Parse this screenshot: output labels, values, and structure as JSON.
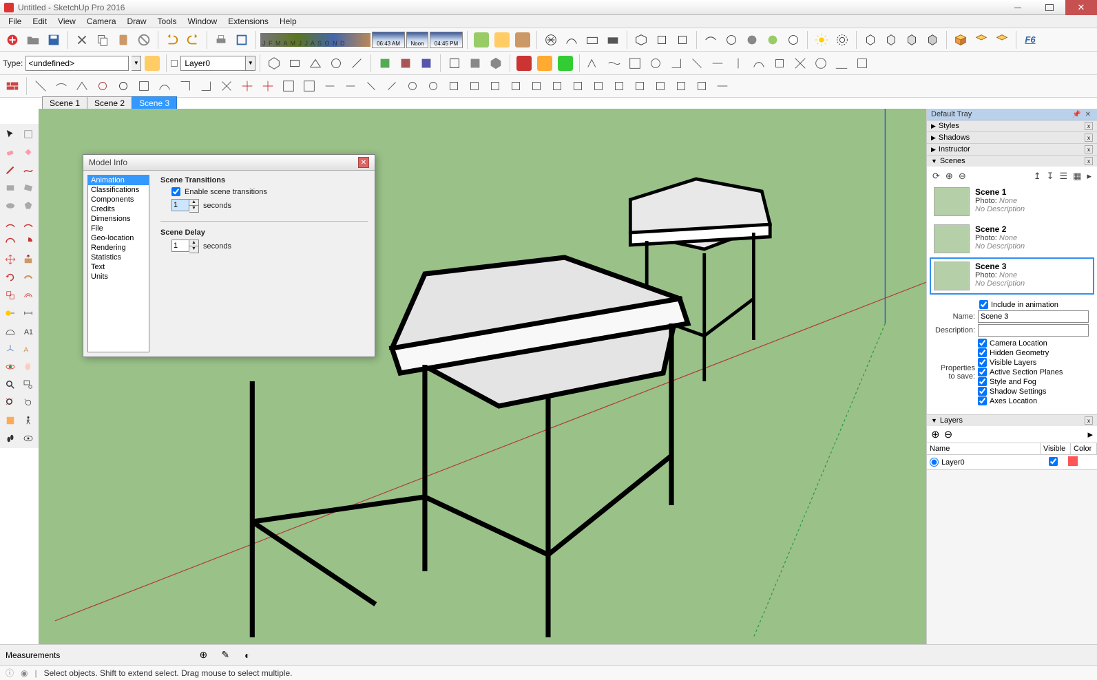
{
  "titlebar": {
    "title": "Untitled - SketchUp Pro 2016"
  },
  "menu": [
    "File",
    "Edit",
    "View",
    "Camera",
    "Draw",
    "Tools",
    "Window",
    "Extensions",
    "Help"
  ],
  "type_label": "Type:",
  "type_value": "<undefined>",
  "layer_dropdown": "Layer0",
  "month_letters": "J F M A M J J A S O N D",
  "time_boxes": {
    "am": "06:43 AM",
    "noon": "Noon",
    "pm": "04:45 PM"
  },
  "scene_tabs": [
    {
      "label": "Scene 1",
      "active": false
    },
    {
      "label": "Scene 2",
      "active": false
    },
    {
      "label": "Scene 3",
      "active": true
    }
  ],
  "tray": {
    "title": "Default Tray",
    "sections": {
      "styles": "Styles",
      "shadows": "Shadows",
      "instructor": "Instructor",
      "scenes": "Scenes",
      "layers": "Layers"
    }
  },
  "scenes_list": [
    {
      "name": "Scene 1",
      "photo_label": "Photo:",
      "photo_value": "None",
      "desc": "No Description",
      "selected": false
    },
    {
      "name": "Scene 2",
      "photo_label": "Photo:",
      "photo_value": "None",
      "desc": "No Description",
      "selected": false
    },
    {
      "name": "Scene 3",
      "photo_label": "Photo:",
      "photo_value": "None",
      "desc": "No Description",
      "selected": true
    }
  ],
  "scene_props": {
    "include_label": "Include in animation",
    "name_label": "Name:",
    "name_value": "Scene 3",
    "desc_label": "Description:",
    "desc_value": "",
    "props_label1": "Properties",
    "props_label2": "to save:",
    "checks": [
      "Camera Location",
      "Hidden Geometry",
      "Visible Layers",
      "Active Section Planes",
      "Style and Fog",
      "Shadow Settings",
      "Axes Location"
    ]
  },
  "layers": {
    "head": {
      "name": "Name",
      "visible": "Visible",
      "color": "Color"
    },
    "rows": [
      {
        "name": "Layer0",
        "visible": true,
        "color": "#ff5555"
      }
    ]
  },
  "model_info": {
    "title": "Model Info",
    "categories": [
      "Animation",
      "Classifications",
      "Components",
      "Credits",
      "Dimensions",
      "File",
      "Geo-location",
      "Rendering",
      "Statistics",
      "Text",
      "Units"
    ],
    "selected_category": "Animation",
    "section1_title": "Scene Transitions",
    "enable_label": "Enable scene transitions",
    "enable_checked": true,
    "transition_value": "1",
    "seconds_label": "seconds",
    "section2_title": "Scene Delay",
    "delay_value": "1"
  },
  "measurements_label": "Measurements",
  "status_hint": "Select objects. Shift to extend select. Drag mouse to select multiple."
}
